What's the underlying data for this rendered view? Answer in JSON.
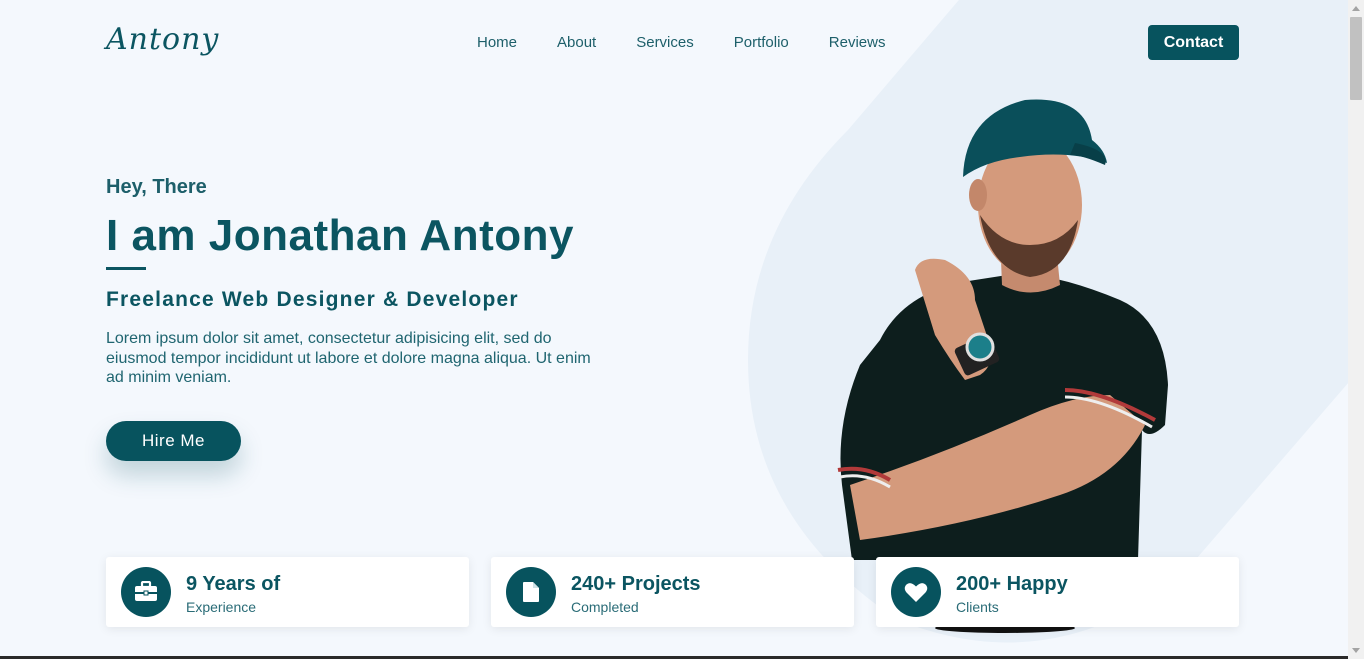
{
  "header": {
    "logo": "Antony",
    "nav": [
      "Home",
      "About",
      "Services",
      "Portfolio",
      "Reviews"
    ],
    "contact_label": "Contact"
  },
  "hero": {
    "greeting": "Hey, There",
    "name": "I am Jonathan Antony",
    "role": "Freelance Web Designer & Developer",
    "description": "Lorem ipsum dolor sit amet, consectetur adipisicing elit, sed do eiusmod tempor incididunt ut labore et dolore magna aliqua. Ut enim ad minim veniam.",
    "cta_label": "Hire Me"
  },
  "stats": [
    {
      "icon": "briefcase-icon",
      "title": "9 Years of",
      "subtitle": "Experience"
    },
    {
      "icon": "document-icon",
      "title": "240+ Projects",
      "subtitle": "Completed"
    },
    {
      "icon": "heart-icon",
      "title": "200+ Happy",
      "subtitle": "Clients"
    }
  ],
  "colors": {
    "primary": "#07535e",
    "background": "#f4f8fd",
    "blob": "#e8f0f8"
  }
}
